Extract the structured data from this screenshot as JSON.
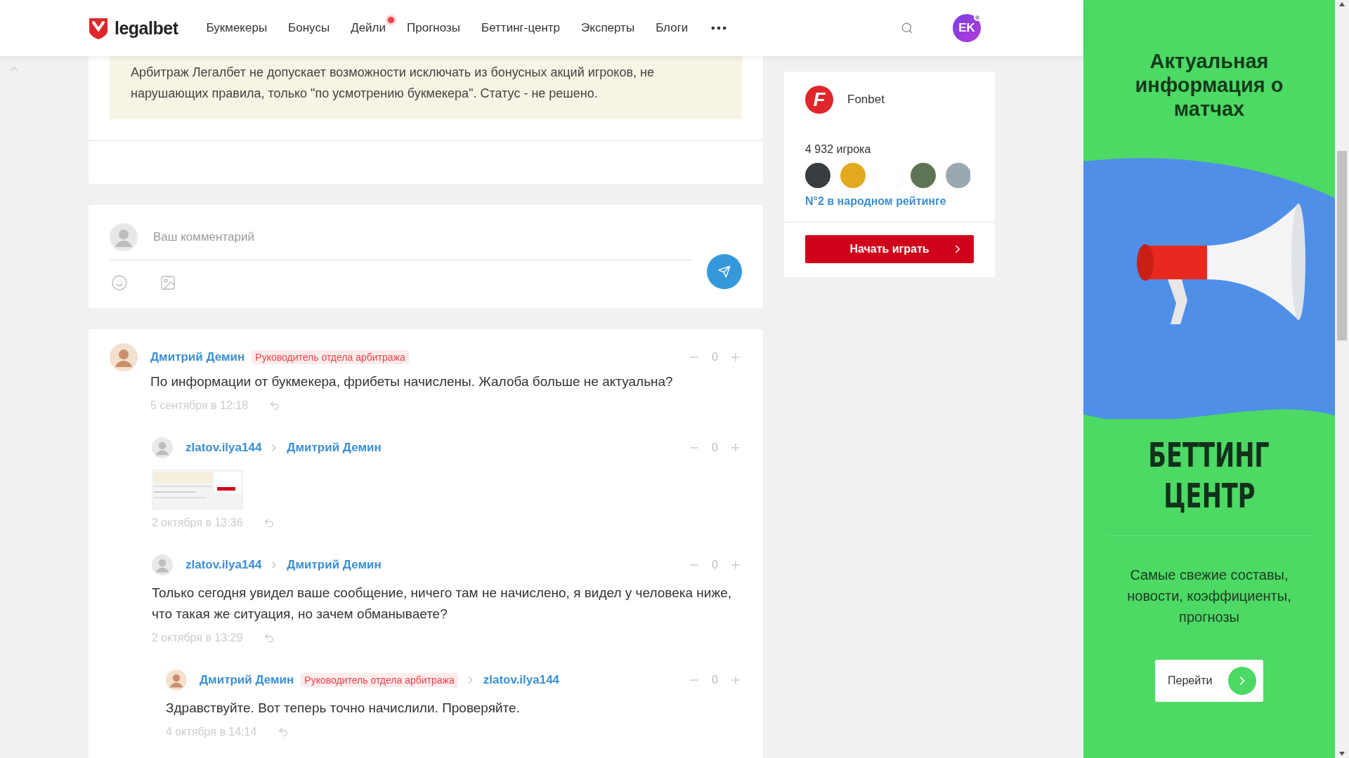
{
  "header": {
    "logo": "legalbet",
    "nav": [
      {
        "label": "Букмекеры",
        "badge": false
      },
      {
        "label": "Бонусы",
        "badge": false
      },
      {
        "label": "Дейли",
        "badge": true
      },
      {
        "label": "Прогнозы",
        "badge": false
      },
      {
        "label": "Беттинг-центр",
        "badge": false
      },
      {
        "label": "Эксперты",
        "badge": false
      },
      {
        "label": "Блоги",
        "badge": false
      }
    ],
    "avatar": "EK"
  },
  "note": {
    "text": "Арбитраж Легалбет не допускает возможности исключать из бонусных акций игроков, не нарушающих правила, только \"по усмотрению букмекера\". Статус - не решено."
  },
  "comment_form": {
    "placeholder": "Ваш комментарий"
  },
  "comments": [
    {
      "photo_avatar": true,
      "author": "Дмитрий Демин",
      "role": "Руководитель отдела арбитража",
      "text": "По информации от букмекера, фрибеты начислены. Жалоба больше не актуальна?",
      "time": "5 сентября в 12:18",
      "votes": "0",
      "children": [
        {
          "photo_avatar": false,
          "author": "zlatov.ilya144",
          "reply_to": "Дмитрий Демин",
          "attachment": true,
          "time": "2 октября в 13:36",
          "votes": "0"
        },
        {
          "photo_avatar": false,
          "author": "zlatov.ilya144",
          "reply_to": "Дмитрий Демин",
          "text": "Только сегодня увидел ваше сообщение, ничего там не начислено, я видел у человека ниже, что такая же ситуация, но зачем обманываете?",
          "time": "2 октября в 13:29",
          "votes": "0",
          "children": [
            {
              "photo_avatar": true,
              "author": "Дмитрий Демин",
              "role": "Руководитель отдела арбитража",
              "reply_to": "zlatov.ilya144",
              "text": "Здравствуйте. Вот теперь точно начислили. Проверяйте.",
              "time": "4 октября в 14:14",
              "votes": "0"
            }
          ]
        }
      ]
    }
  ],
  "bookmaker": {
    "logo_letter": "F",
    "name": "Fonbet",
    "players": "4 932 игрока",
    "rating": "N°2 в народном рейтинге",
    "button": "Начать играть"
  },
  "ad": {
    "title": "Актуальная информация о матчах",
    "heading": [
      "БЕТТИНГ",
      "ЦЕНТР"
    ],
    "text": "Самые свежие составы, новости, коэффициенты, прогнозы",
    "button": "Перейти"
  }
}
